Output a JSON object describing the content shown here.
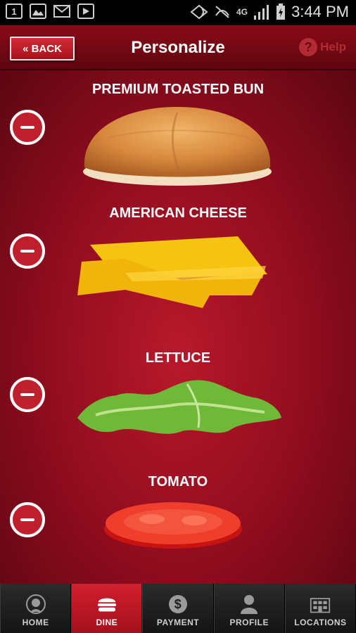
{
  "status_bar": {
    "notification_badge": "1",
    "network": "4G",
    "time": "3:44 PM"
  },
  "header": {
    "back_label": "« BACK",
    "title": "Personalize",
    "help_label": "Help",
    "help_symbol": "?"
  },
  "ingredients": [
    {
      "label": "PREMIUM TOASTED BUN"
    },
    {
      "label": "AMERICAN CHEESE"
    },
    {
      "label": "LETTUCE"
    },
    {
      "label": "TOMATO"
    }
  ],
  "tabs": [
    {
      "label": "HOME",
      "icon": "wendys-logo-icon",
      "active": false
    },
    {
      "label": "DINE",
      "icon": "burger-icon",
      "active": true
    },
    {
      "label": "PAYMENT",
      "icon": "dollar-icon",
      "active": false
    },
    {
      "label": "PROFILE",
      "icon": "person-icon",
      "active": false
    },
    {
      "label": "LOCATIONS",
      "icon": "building-icon",
      "active": false
    }
  ],
  "colors": {
    "brand_red": "#c0202e",
    "header_red": "#8a0a16",
    "tabbar": "#1e1e1e"
  }
}
